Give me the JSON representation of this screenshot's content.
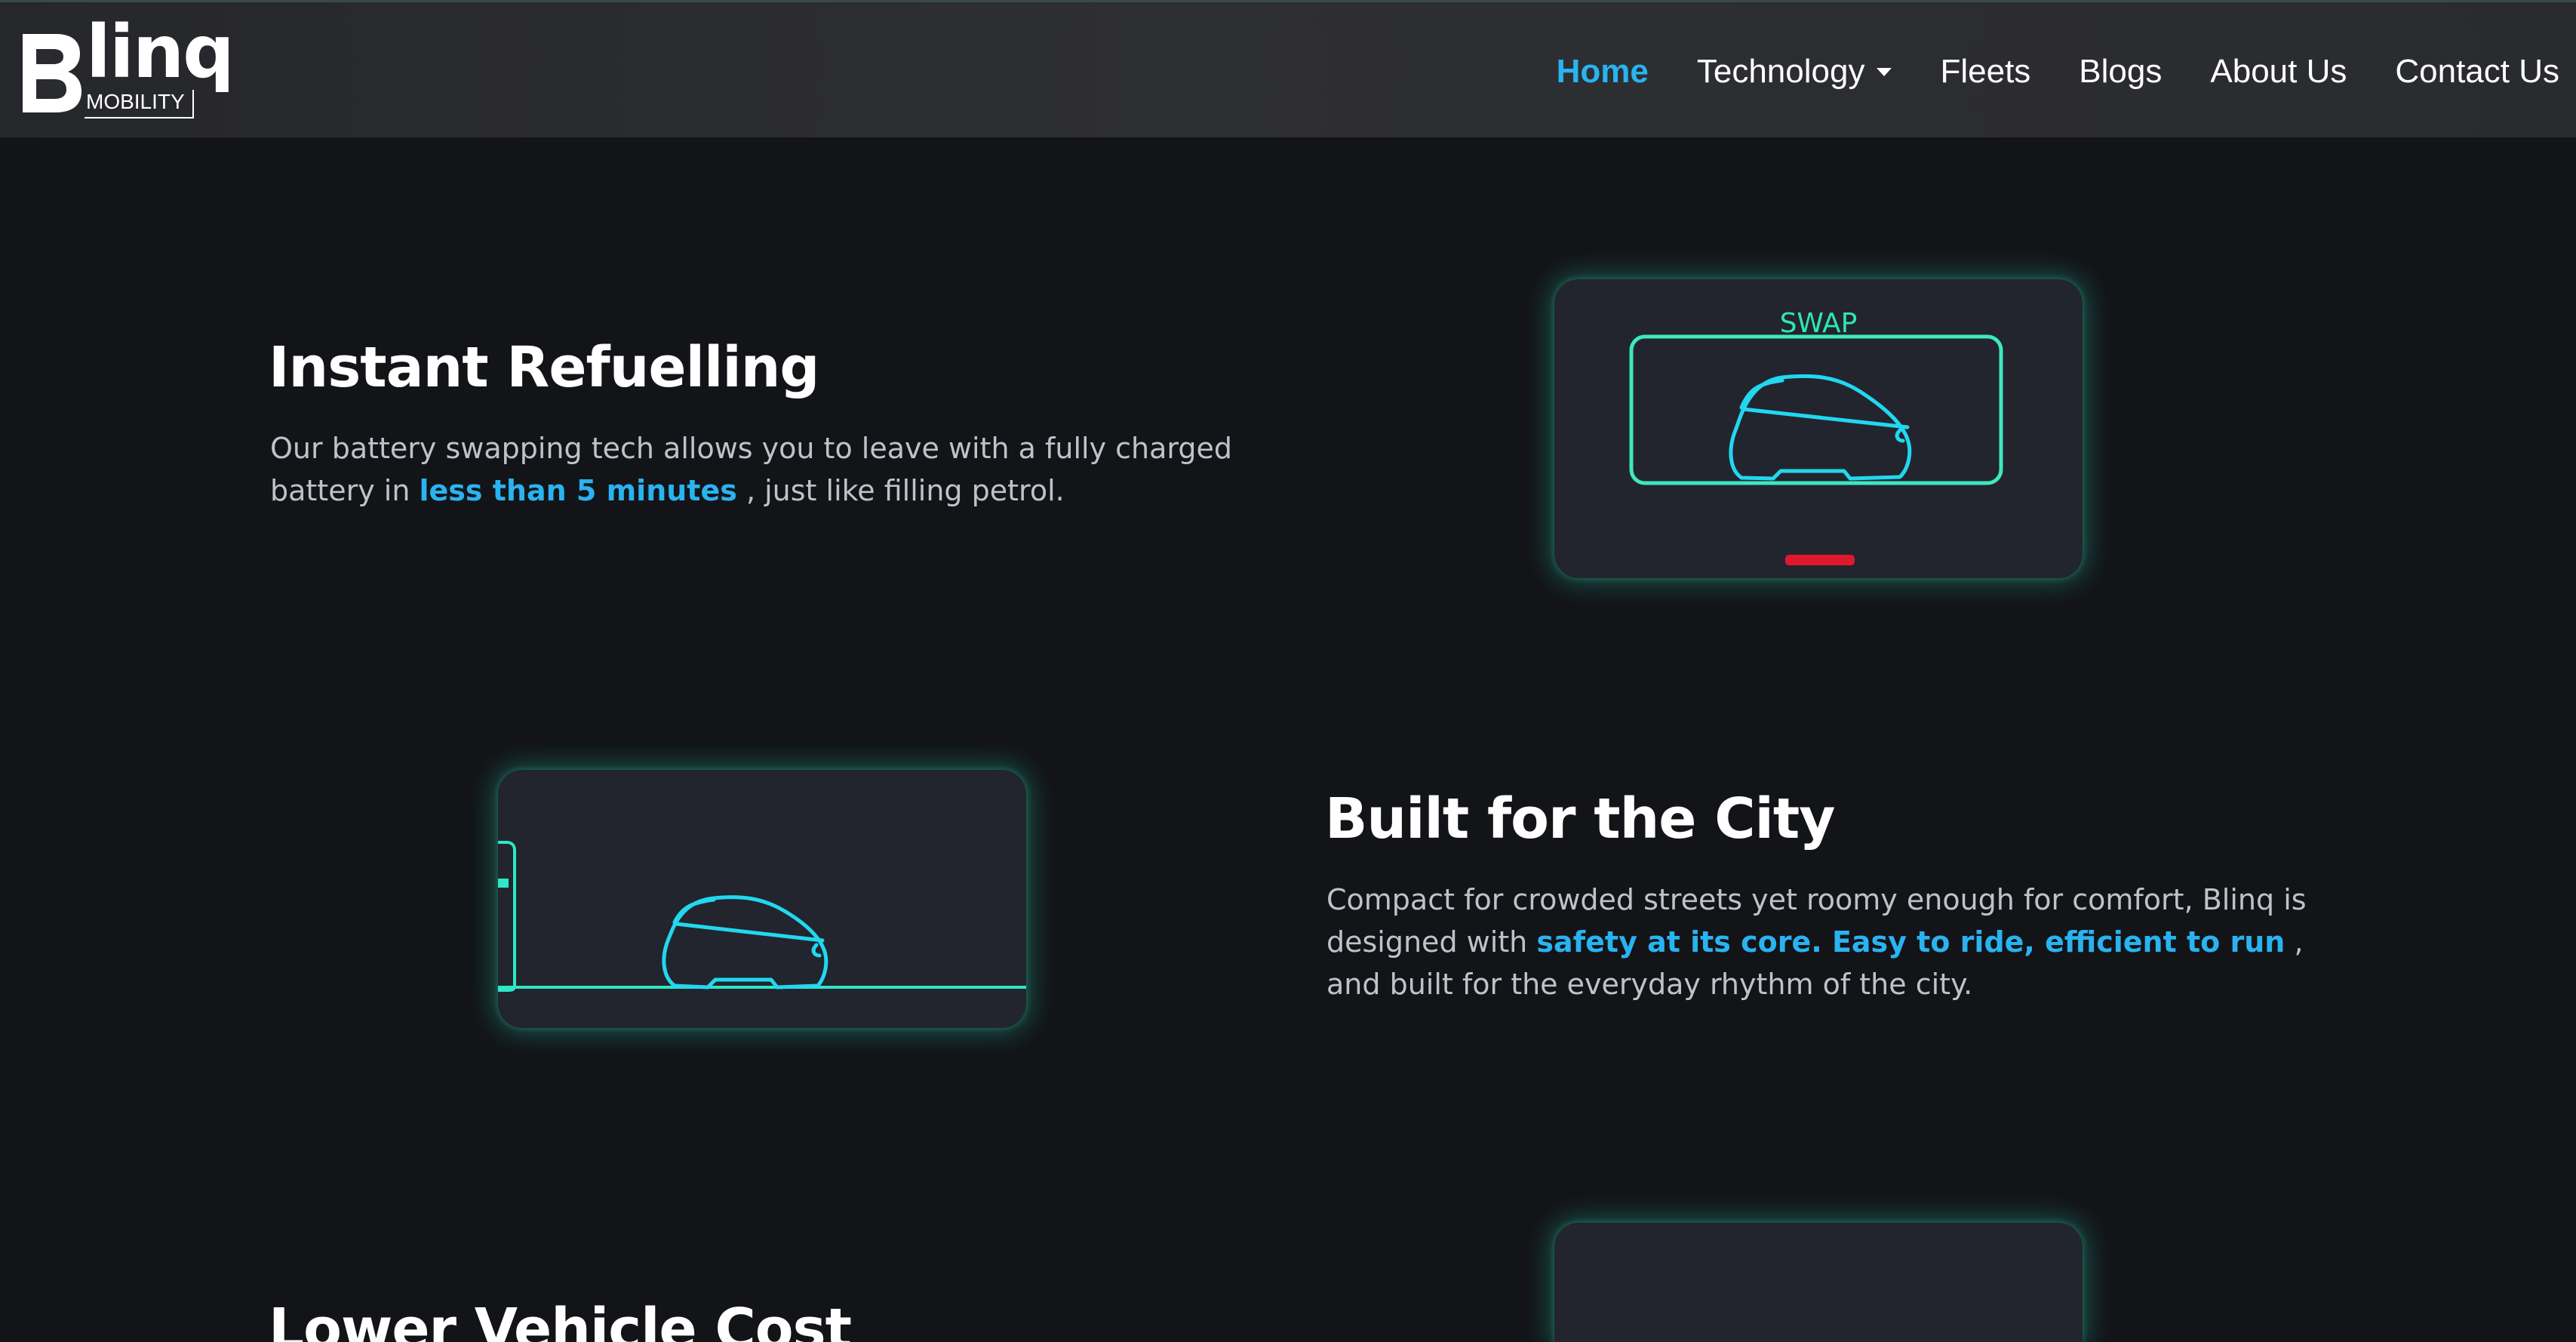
{
  "brand": {
    "logo_text": "linq",
    "logo_sub": "MOBILITY"
  },
  "nav": {
    "items": [
      {
        "label": "Home",
        "active": true
      },
      {
        "label": "Technology",
        "has_dropdown": true
      },
      {
        "label": "Fleets"
      },
      {
        "label": "Blogs"
      },
      {
        "label": "About Us"
      },
      {
        "label": "Contact Us"
      }
    ]
  },
  "sections": {
    "refuel": {
      "title": "Instant Refuelling",
      "text_1": "Our battery swapping tech allows you to leave with a fully charged battery in ",
      "highlight": "less than 5 minutes",
      "text_2": " , just like filling petrol.",
      "card_label": "SWAP"
    },
    "city": {
      "title": "Built for the City",
      "text_1": "Compact for crowded streets yet roomy enough for comfort, Blinq is designed with ",
      "highlight": "safety at its core. Easy to ride, efficient to run",
      "text_2": " , and built for the everyday rhythm of the city."
    },
    "cost": {
      "title": "Lower Vehicle Cost"
    }
  },
  "colors": {
    "accent": "#29b3f0",
    "glow": "#2ee6c8",
    "card": "#22252d",
    "background": "#131418",
    "indicator": "#e0182d"
  }
}
